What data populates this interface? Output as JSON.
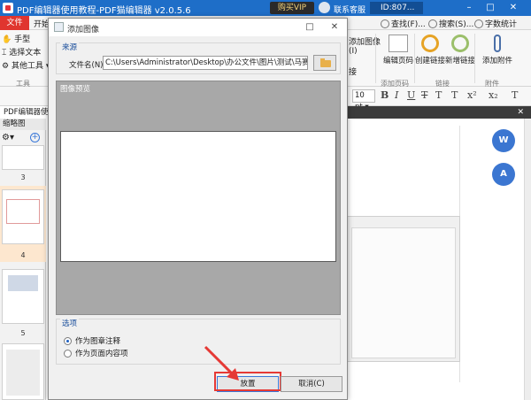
{
  "app": {
    "title": "PDF编辑器使用教程-PDF猫编辑器 v2.0.5.6",
    "vip_label": "购买VIP",
    "support_label": "联系客服",
    "user_id": "ID:807..."
  },
  "ribbon": {
    "file_tab": "文件",
    "start_tab": "开始",
    "quick_find": "查找(F)...",
    "quick_search": "搜索(S)...",
    "quick_wordcount": "字数统计",
    "left_tools": [
      "手型",
      "选择文本",
      "其他工具"
    ],
    "tools_group": "工具",
    "add_image": "添加图像(I)",
    "add_link_partial": "接",
    "edit_page_code": "编辑页码",
    "create_link": "创建链接",
    "new_link": "新增链接",
    "add_attachment": "添加附件",
    "group_page_code": "添加页码",
    "group_link": "链接",
    "group_attachment": "附件"
  },
  "toolbar2": {
    "font_size": "10 pt"
  },
  "doc": {
    "tab_label": "PDF编辑器使用教程"
  },
  "thumbs": {
    "title": "缩略图",
    "pages": [
      "3",
      "4",
      "5"
    ]
  },
  "dialog": {
    "title": "添加图像",
    "source_label": "来源",
    "file_name_label": "文件名(N):",
    "file_path": "C:\\Users\\Administrator\\Desktop\\办公文件\\图片\\测试\\马赛克图片",
    "preview_label": "图像预览",
    "options_label": "选项",
    "option_annotation": "作为图章注释",
    "option_content": "作为页面内容项",
    "place_button": "放置",
    "cancel_button": "取消(C)"
  },
  "floating": {
    "btn1": "W",
    "btn2": "A"
  },
  "colors": {
    "titlebar": "#1e6ec8",
    "file_tab": "#e0352f",
    "highlight": "#e53935",
    "float_btn": "#3b76d1"
  }
}
